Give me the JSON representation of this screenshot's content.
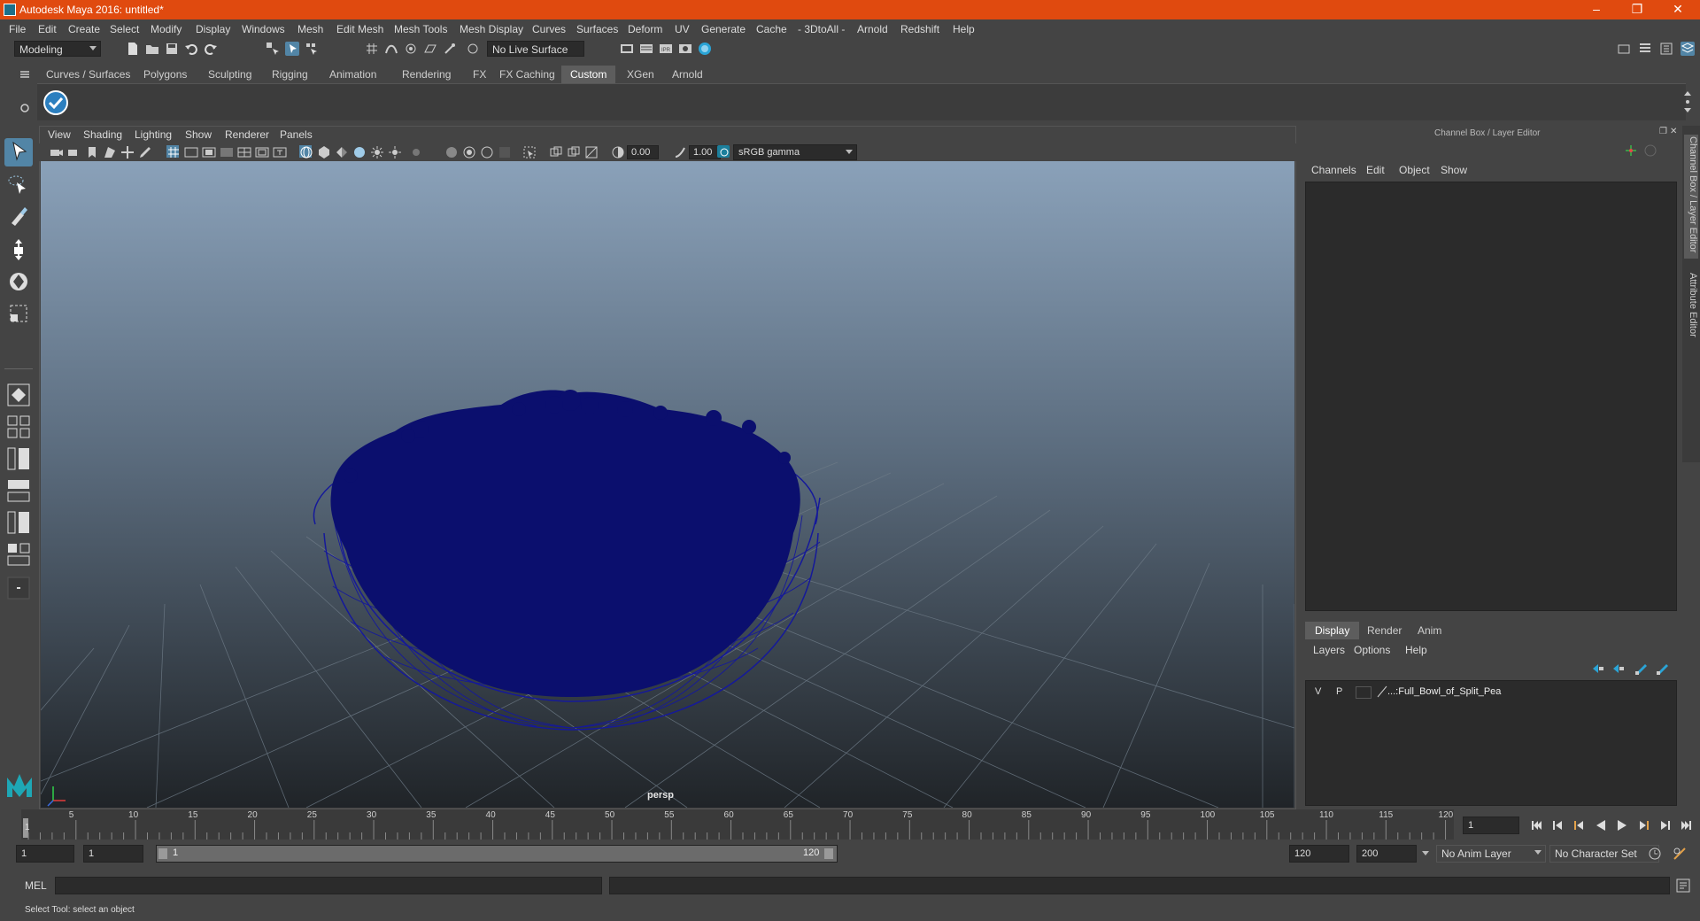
{
  "window": {
    "title": "Autodesk Maya 2016: untitled*"
  },
  "menubar": [
    "File",
    "Edit",
    "Create",
    "Select",
    "Modify",
    "Display",
    "Windows",
    "Mesh",
    "Edit Mesh",
    "Mesh Tools",
    "Mesh Display",
    "Curves",
    "Surfaces",
    "Deform",
    "UV",
    "Generate",
    "Cache",
    "- 3DtoAll -",
    "Arnold",
    "Redshift",
    "Help"
  ],
  "statusline": {
    "mode": "Modeling",
    "live_surface": "No Live Surface"
  },
  "shelf": {
    "tabs": [
      "Curves / Surfaces",
      "Polygons",
      "Sculpting",
      "Rigging",
      "Animation",
      "Rendering",
      "FX",
      "FX Caching",
      "Custom",
      "XGen",
      "Arnold"
    ],
    "active_tab": "Custom"
  },
  "viewport": {
    "menu": [
      "View",
      "Shading",
      "Lighting",
      "Show",
      "Renderer",
      "Panels"
    ],
    "exposure": "0.00",
    "gamma": "1.00",
    "color_space": "sRGB gamma",
    "camera_label": "persp"
  },
  "channel_box": {
    "title": "Channel Box / Layer Editor",
    "menu": [
      "Channels",
      "Edit",
      "Object",
      "Show"
    ],
    "layer_tabs": [
      "Display",
      "Render",
      "Anim"
    ],
    "active_layer_tab": "Display",
    "layer_menu": [
      "Layers",
      "Options",
      "Help"
    ],
    "layers": [
      {
        "v": "V",
        "p": "P",
        "name": "...:Full_Bowl_of_Split_Pea"
      }
    ]
  },
  "side_tabs": [
    "Channel Box / Layer Editor",
    "Attribute Editor"
  ],
  "timeline": {
    "ticks": [
      "5",
      "10",
      "15",
      "20",
      "25",
      "30",
      "35",
      "40",
      "45",
      "50",
      "55",
      "60",
      "65",
      "70",
      "75",
      "80",
      "85",
      "90",
      "95",
      "100",
      "105",
      "110",
      "115",
      "120"
    ],
    "first_label": "1",
    "current_frame": "1"
  },
  "range": {
    "start": "1",
    "playback_start": "1",
    "slider_start": "1",
    "slider_end": "120",
    "playback_end": "120",
    "end": "200",
    "anim_layer": "No Anim Layer",
    "character_set": "No Character Set"
  },
  "command_line": {
    "label": "MEL"
  },
  "help_line": {
    "text": "Select Tool: select an object"
  },
  "colors": {
    "titlebar": "#e04a0f",
    "accent": "#5285a6",
    "mesh": "#0b0f6e"
  }
}
